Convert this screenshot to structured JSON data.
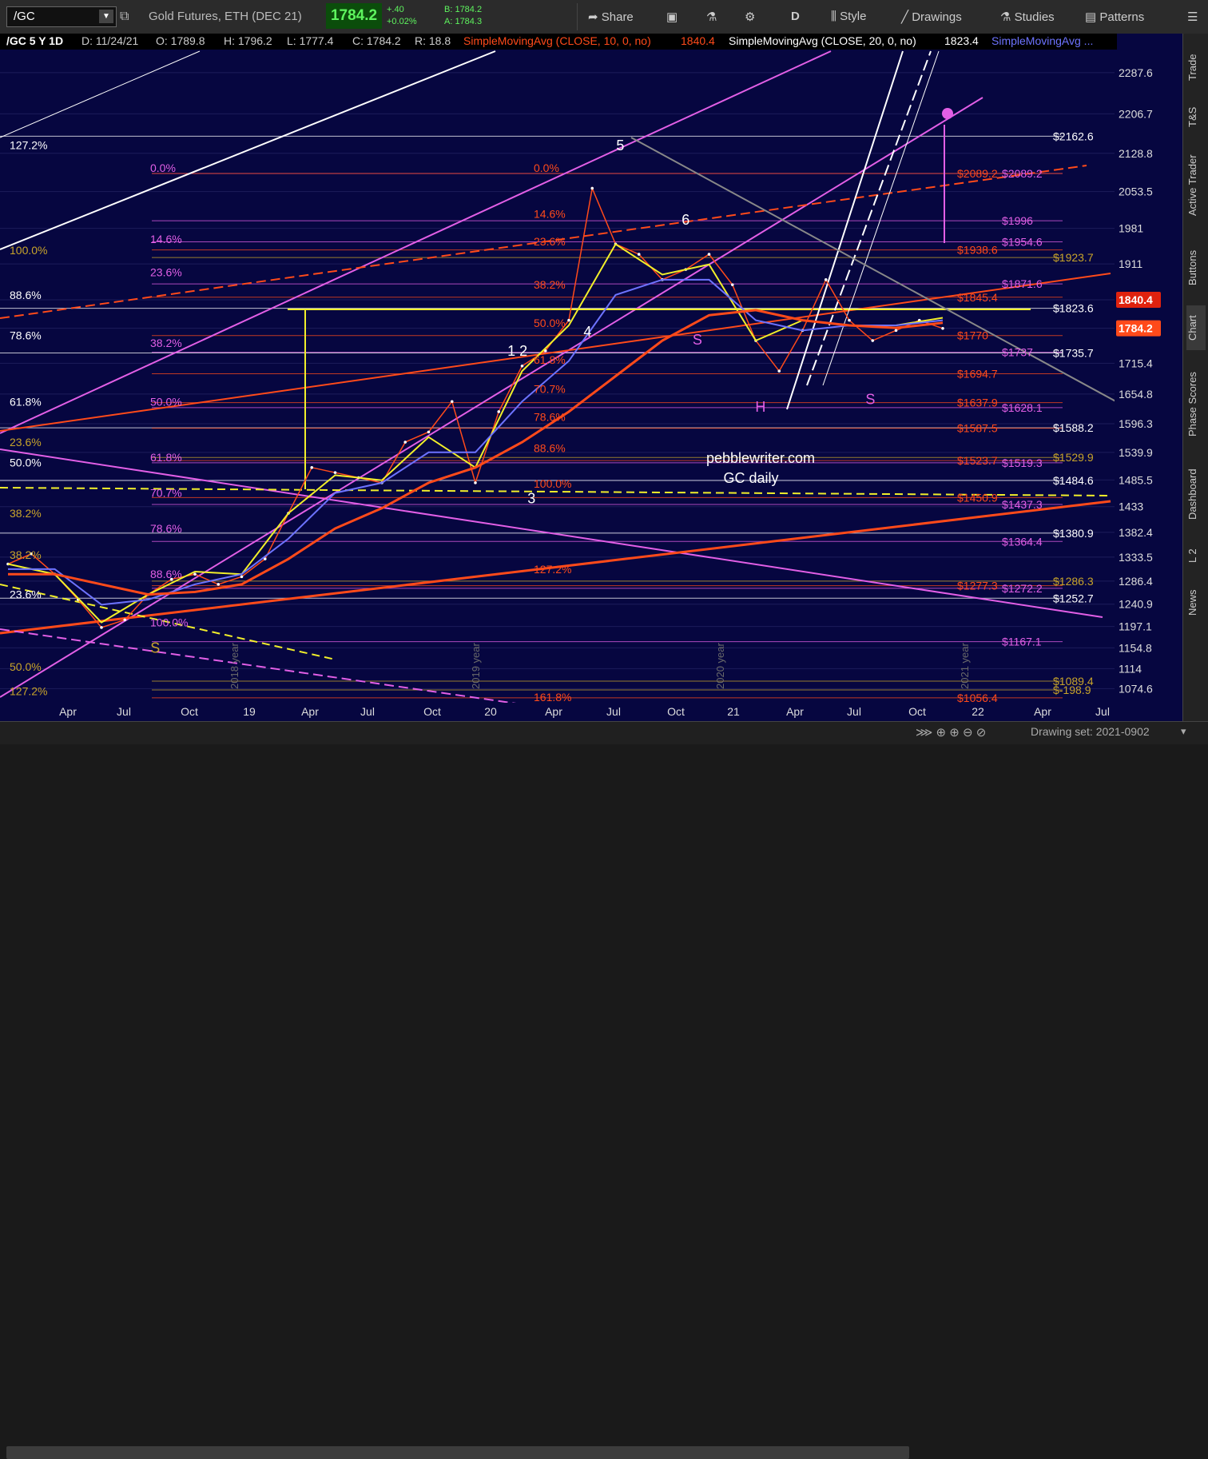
{
  "toolbar": {
    "symbol": "/GC",
    "title": "Gold Futures, ETH (DEC 21)",
    "last": "1784.2",
    "change": "+.40",
    "change_pct": "+0.02%",
    "bid": "B: 1784.2",
    "ask": "A: 1784.3",
    "share_label": "Share",
    "period_label": "D",
    "style_label": "Style",
    "drawings_label": "Drawings",
    "studies_label": "Studies",
    "patterns_label": "Patterns"
  },
  "header": {
    "symbol": "/GC 5 Y 1D",
    "date": "D: 11/24/21",
    "open": "O: 1789.8",
    "high": "H: 1796.2",
    "low": "L: 1777.4",
    "close": "C: 1784.2",
    "range": "R: 18.8",
    "sma10": "SimpleMovingAvg (CLOSE, 10, 0, no)",
    "sma10_val": "1840.4",
    "sma20": "SimpleMovingAvg (CLOSE, 20, 0, no)",
    "sma20_val": "1823.4",
    "sma3": "SimpleMovingAvg ..."
  },
  "right_tabs": [
    "Trade",
    "T&S",
    "Active Trader",
    "Buttons",
    "Chart",
    "Phase Scores",
    "Dashboard",
    "L 2",
    "News"
  ],
  "watermark": {
    "line1": "pebblewriter.com",
    "line2": "GC daily"
  },
  "status": {
    "drawing_set": "Drawing set: 2021-0902"
  },
  "colors": {
    "background": "#060640",
    "pink": "#e25fe6",
    "orange": "#ff4a1a",
    "white": "#ffffff",
    "yellow": "#f1ef2a",
    "blue": "#6d73ff",
    "gold": "#c8a42a"
  },
  "chart_data": {
    "type": "line",
    "title": "",
    "xlabel": "",
    "ylabel": "",
    "x_ticks": [
      "Apr",
      "Jul",
      "Oct",
      "19",
      "Apr",
      "Jul",
      "Oct",
      "20",
      "Apr",
      "Jul",
      "Oct",
      "21",
      "Apr",
      "Jul",
      "Oct",
      "22",
      "Apr",
      "Jul"
    ],
    "y_ticks": [
      2287.6,
      2206.7,
      2128.8,
      2053.5,
      1981,
      1911,
      1840.4,
      1784.2,
      1715.4,
      1654.8,
      1596.3,
      1539.9,
      1485.5,
      1433,
      1382.4,
      1333.5,
      1286.4,
      1240.9,
      1197.1,
      1154.8,
      1114,
      1074.6
    ],
    "ylim": [
      1050,
      2330
    ],
    "current_price_label": "1840.4",
    "current_price_label2": "1784.2",
    "year_labels": [
      "2018 year",
      "2019 year",
      "2020 year",
      "2021 year"
    ],
    "series": [
      {
        "name": "price",
        "x": [
          0,
          10,
          20,
          30,
          40,
          50,
          60,
          70,
          80,
          90,
          100,
          110,
          120,
          130,
          140,
          150,
          160,
          170,
          180,
          190,
          200,
          210,
          220,
          230,
          240,
          250,
          260,
          270,
          280,
          290,
          300,
          310,
          320,
          330,
          340,
          350,
          360,
          370,
          380,
          390,
          400
        ],
        "values": [
          1320,
          1340,
          1300,
          1250,
          1195,
          1210,
          1260,
          1290,
          1300,
          1280,
          1295,
          1330,
          1420,
          1510,
          1500,
          1490,
          1480,
          1560,
          1580,
          1640,
          1480,
          1620,
          1710,
          1740,
          1800,
          2060,
          1950,
          1930,
          1880,
          1900,
          1930,
          1870,
          1760,
          1700,
          1780,
          1880,
          1800,
          1760,
          1780,
          1800,
          1784
        ]
      },
      {
        "name": "sma_fast",
        "x": [
          0,
          20,
          40,
          60,
          80,
          100,
          120,
          140,
          160,
          180,
          200,
          220,
          240,
          260,
          280,
          300,
          320,
          340,
          360,
          380,
          400
        ],
        "values": [
          1320,
          1300,
          1205,
          1260,
          1305,
          1300,
          1420,
          1495,
          1485,
          1570,
          1510,
          1700,
          1790,
          1950,
          1890,
          1910,
          1760,
          1800,
          1790,
          1790,
          1805
        ]
      },
      {
        "name": "sma_slow",
        "x": [
          0,
          20,
          40,
          60,
          80,
          100,
          120,
          140,
          160,
          180,
          200,
          220,
          240,
          260,
          280,
          300,
          320,
          340,
          360,
          380,
          400
        ],
        "values": [
          1310,
          1310,
          1240,
          1250,
          1280,
          1300,
          1370,
          1460,
          1480,
          1540,
          1540,
          1640,
          1720,
          1850,
          1880,
          1880,
          1800,
          1780,
          1790,
          1790,
          1800
        ]
      },
      {
        "name": "sma_long",
        "x": [
          0,
          20,
          40,
          60,
          80,
          100,
          120,
          140,
          160,
          180,
          200,
          220,
          240,
          260,
          280,
          300,
          320,
          340,
          360,
          380,
          400
        ],
        "values": [
          1300,
          1300,
          1280,
          1260,
          1265,
          1280,
          1330,
          1390,
          1430,
          1480,
          1510,
          1560,
          1620,
          1690,
          1760,
          1810,
          1820,
          1800,
          1790,
          1785,
          1795
        ]
      }
    ],
    "right_labels": [
      {
        "text": "$2162.6",
        "value": 2162.6,
        "color": "#ffffff"
      },
      {
        "text": "$2089.2",
        "value": 2089.2,
        "color": "#e25fe6"
      },
      {
        "text": "$2089.2",
        "value": 2089.2,
        "color": "#ff4a1a"
      },
      {
        "text": "$1996",
        "value": 1996,
        "color": "#e25fe6"
      },
      {
        "text": "$1954.6",
        "value": 1954.6,
        "color": "#e25fe6"
      },
      {
        "text": "$1938.6",
        "value": 1938.6,
        "color": "#ff4a1a"
      },
      {
        "text": "$1923.7",
        "value": 1923.7,
        "color": "#c8a42a"
      },
      {
        "text": "$1871.6",
        "value": 1871.6,
        "color": "#e25fe6"
      },
      {
        "text": "$1845.4",
        "value": 1845.4,
        "color": "#ff4a1a"
      },
      {
        "text": "$1823.6",
        "value": 1823.6,
        "color": "#ffffff"
      },
      {
        "text": "$1770",
        "value": 1770,
        "color": "#ff4a1a"
      },
      {
        "text": "$1737",
        "value": 1737,
        "color": "#e25fe6"
      },
      {
        "text": "$1735.7",
        "value": 1735.7,
        "color": "#ffffff"
      },
      {
        "text": "$1694.7",
        "value": 1694.7,
        "color": "#ff4a1a"
      },
      {
        "text": "$1637.9",
        "value": 1637.9,
        "color": "#ff4a1a"
      },
      {
        "text": "$1628.1",
        "value": 1628.1,
        "color": "#e25fe6"
      },
      {
        "text": "$1588.2",
        "value": 1588.2,
        "color": "#ffffff"
      },
      {
        "text": "$1587.5",
        "value": 1587.5,
        "color": "#ff4a1a"
      },
      {
        "text": "$1529.9",
        "value": 1529.9,
        "color": "#c8a42a"
      },
      {
        "text": "$1523.7",
        "value": 1523.7,
        "color": "#ff4a1a"
      },
      {
        "text": "$1519.3",
        "value": 1519.3,
        "color": "#e25fe6"
      },
      {
        "text": "$1484.6",
        "value": 1484.6,
        "color": "#ffffff"
      },
      {
        "text": "$1450.9",
        "value": 1450.9,
        "color": "#ff4a1a"
      },
      {
        "text": "$1437.3",
        "value": 1437.3,
        "color": "#e25fe6"
      },
      {
        "text": "$1380.9",
        "value": 1380.9,
        "color": "#ffffff"
      },
      {
        "text": "$1364.4",
        "value": 1364.4,
        "color": "#e25fe6"
      },
      {
        "text": "$1286.3",
        "value": 1286.3,
        "color": "#c8a42a"
      },
      {
        "text": "$1277.3",
        "value": 1277.3,
        "color": "#ff4a1a"
      },
      {
        "text": "$1272.2",
        "value": 1272.2,
        "color": "#e25fe6"
      },
      {
        "text": "$1252.7",
        "value": 1252.7,
        "color": "#ffffff"
      },
      {
        "text": "$1167.1",
        "value": 1167.1,
        "color": "#e25fe6"
      },
      {
        "text": "$1089.4",
        "value": 1089.4,
        "color": "#c8a42a"
      },
      {
        "text": "$1056.4",
        "value": 1056.4,
        "color": "#ff4a1a"
      },
      {
        "text": "$-198.9",
        "value": 1072,
        "color": "#c8a42a"
      }
    ],
    "left_fib_labels": [
      {
        "text": "127.2%",
        "value": 2145,
        "color": "#ffffff"
      },
      {
        "text": "100.0%",
        "value": 1938,
        "color": "#c8a42a"
      },
      {
        "text": "88.6%",
        "value": 1850,
        "color": "#ffffff"
      },
      {
        "text": "78.6%",
        "value": 1770,
        "color": "#ffffff"
      },
      {
        "text": "61.8%",
        "value": 1640,
        "color": "#ffffff"
      },
      {
        "text": "23.6%",
        "value": 1560,
        "color": "#c8a42a"
      },
      {
        "text": "50.0%",
        "value": 1520,
        "color": "#ffffff"
      },
      {
        "text": "38.2%",
        "value": 1420,
        "color": "#c8a42a"
      },
      {
        "text": "38.2%",
        "value": 1338,
        "color": "#c8a42a"
      },
      {
        "text": "23.6%",
        "value": 1260,
        "color": "#ffffff"
      },
      {
        "text": "50.0%",
        "value": 1118,
        "color": "#c8a42a"
      },
      {
        "text": "127.2%",
        "value": 1070,
        "color": "#c8a42a"
      }
    ],
    "mid_fib_labels": [
      {
        "text": "0.0%",
        "value": 2100,
        "color": "#e25fe6"
      },
      {
        "text": "14.6%",
        "value": 1960,
        "color": "#e25fe6"
      },
      {
        "text": "23.6%",
        "value": 1895,
        "color": "#e25fe6"
      },
      {
        "text": "38.2%",
        "value": 1755,
        "color": "#e25fe6"
      },
      {
        "text": "50.0%",
        "value": 1640,
        "color": "#e25fe6"
      },
      {
        "text": "61.8%",
        "value": 1530,
        "color": "#e25fe6"
      },
      {
        "text": "70.7%",
        "value": 1460,
        "color": "#e25fe6"
      },
      {
        "text": "78.6%",
        "value": 1390,
        "color": "#e25fe6"
      },
      {
        "text": "88.6%",
        "value": 1300,
        "color": "#e25fe6"
      },
      {
        "text": "100.0%",
        "value": 1205,
        "color": "#e25fe6"
      }
    ],
    "right_fib_labels": [
      {
        "text": "0.0%",
        "value": 2100,
        "color": "#ff4a1a"
      },
      {
        "text": "14.6%",
        "value": 2010,
        "color": "#ff4a1a"
      },
      {
        "text": "23.6%",
        "value": 1955,
        "color": "#ff4a1a"
      },
      {
        "text": "38.2%",
        "value": 1870,
        "color": "#ff4a1a"
      },
      {
        "text": "50.0%",
        "value": 1795,
        "color": "#ff4a1a"
      },
      {
        "text": "61.8%",
        "value": 1722,
        "color": "#ff4a1a"
      },
      {
        "text": "70.7%",
        "value": 1665,
        "color": "#ff4a1a"
      },
      {
        "text": "78.6%",
        "value": 1610,
        "color": "#ff4a1a"
      },
      {
        "text": "88.6%",
        "value": 1548,
        "color": "#ff4a1a"
      },
      {
        "text": "100.0%",
        "value": 1478,
        "color": "#ff4a1a"
      },
      {
        "text": "127.2%",
        "value": 1310,
        "color": "#ff4a1a"
      },
      {
        "text": "161.8%",
        "value": 1058,
        "color": "#ff4a1a"
      }
    ],
    "wave_labels": [
      {
        "text": "5",
        "x": 262,
        "value": 2135,
        "color": "#ffffff"
      },
      {
        "text": "6",
        "x": 290,
        "value": 1988,
        "color": "#ffffff"
      },
      {
        "text": "4",
        "x": 248,
        "value": 1768,
        "color": "#ffffff"
      },
      {
        "text": "1 2",
        "x": 218,
        "value": 1730,
        "color": "#ffffff"
      },
      {
        "text": "3",
        "x": 224,
        "value": 1440,
        "color": "#ffffff"
      },
      {
        "text": "S",
        "x": 295,
        "value": 1752,
        "color": "#e25fe6"
      },
      {
        "text": "H",
        "x": 322,
        "value": 1620,
        "color": "#e25fe6"
      },
      {
        "text": "S",
        "x": 369,
        "value": 1635,
        "color": "#e25fe6"
      },
      {
        "text": "S",
        "x": 63,
        "value": 1145,
        "color": "#c8a42a"
      }
    ]
  }
}
